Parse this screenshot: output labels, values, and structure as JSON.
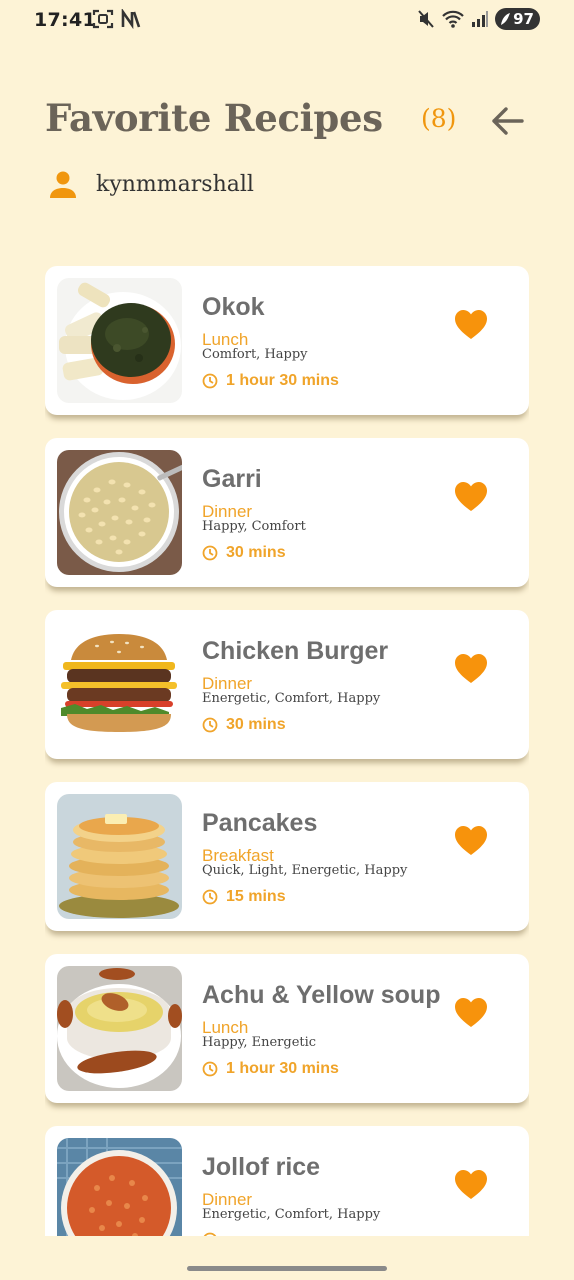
{
  "status_bar": {
    "time": "17:41",
    "battery": "97",
    "icons": [
      "screenshot-icon",
      "n-icon",
      "mute-icon",
      "wifi-icon",
      "signal-icon",
      "battery-icon"
    ]
  },
  "header": {
    "title": "Favorite Recipes",
    "count": "(8)",
    "back_icon": "arrow-left-icon"
  },
  "user": {
    "name": "kynmmarshall",
    "icon": "person-icon"
  },
  "colors": {
    "background": "#fdf3d6",
    "accent": "#f0960e",
    "card": "#ffffff"
  },
  "recipes": [
    {
      "name": "Okok",
      "meal": "Lunch",
      "moods": "Comfort, Happy",
      "time": "1 hour 30 mins"
    },
    {
      "name": "Garri",
      "meal": "Dinner",
      "moods": "Happy, Comfort",
      "time": "30 mins"
    },
    {
      "name": "Chicken Burger",
      "meal": "Dinner",
      "moods": "Energetic, Comfort, Happy",
      "time": "30 mins"
    },
    {
      "name": "Pancakes",
      "meal": "Breakfast",
      "moods": "Quick, Light, Energetic, Happy",
      "time": "15 mins"
    },
    {
      "name": "Achu & Yellow soup",
      "meal": "Lunch",
      "moods": "Happy, Energetic",
      "time": "1 hour 30 mins"
    },
    {
      "name": "Jollof rice",
      "meal": "Dinner",
      "moods": "Energetic, Comfort, Happy",
      "time": ""
    }
  ]
}
